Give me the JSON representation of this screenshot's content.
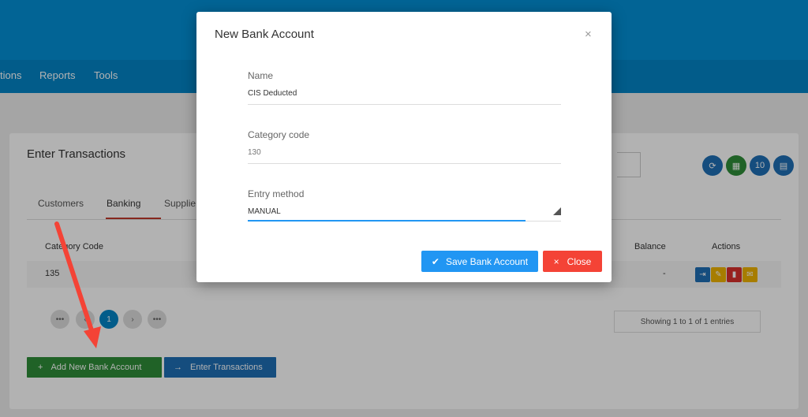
{
  "nav": {
    "items": [
      "tions",
      "Reports",
      "Tools"
    ]
  },
  "panel": {
    "title": "Enter Transactions",
    "toolbar": {
      "refresh_icon": "refresh-icon",
      "excel_icon": "excel-icon",
      "page_size": "10",
      "columns_icon": "grid-icon"
    },
    "tabs": [
      "Customers",
      "Banking",
      "Supplie"
    ],
    "active_tab": "Banking",
    "table": {
      "headers": [
        "Category Code",
        "Balance",
        "Actions"
      ],
      "rows": [
        {
          "category_code": "135",
          "balance": "-"
        }
      ]
    },
    "pagination": {
      "first": "•••",
      "prev": "‹",
      "current": "1",
      "next": "›",
      "last": "•••"
    },
    "showing": "Showing 1 to 1 of 1 entries",
    "add_button": {
      "icon": "+",
      "label": "Add New Bank Account"
    },
    "enter_button": {
      "icon": "→",
      "label": "Enter Transactions"
    }
  },
  "modal": {
    "title": "New Bank Account",
    "close_icon": "×",
    "fields": [
      {
        "label": "Name",
        "value": "CIS Deducted"
      },
      {
        "label": "Category code",
        "value": "130"
      },
      {
        "label": "Entry method",
        "value": "MANUAL"
      }
    ],
    "save_button": {
      "icon": "✔",
      "label": "Save Bank Account"
    },
    "close_button": {
      "icon": "×",
      "label": "Close"
    }
  },
  "colors": {
    "primary": "#0390d6",
    "green": "#2f8d38",
    "blue": "#2196f3",
    "red": "#f44336"
  }
}
